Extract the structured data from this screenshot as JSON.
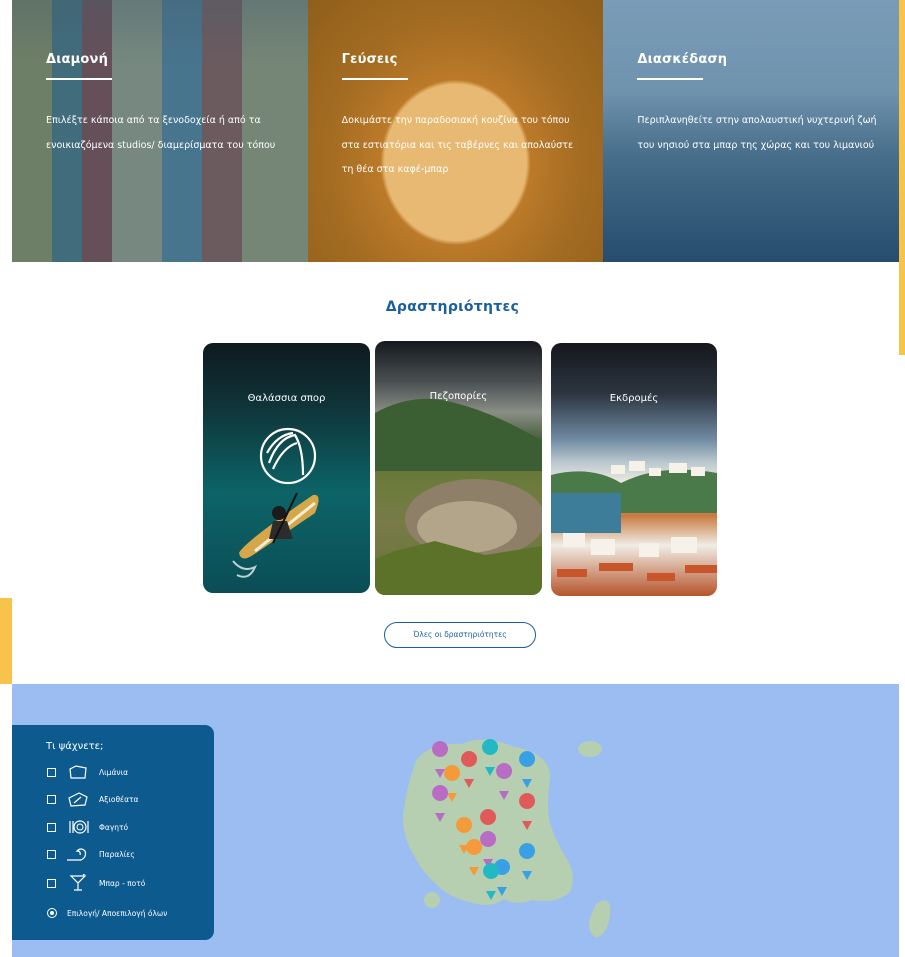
{
  "top_panels": [
    {
      "title": "Διαμονή",
      "text": "Επιλέξτε κάποια από τα ξενοδοχεία ή από τα ενοικιαζόμενα studios/ διαμερίσματα του τόπου"
    },
    {
      "title": "Γεύσεις",
      "text": "Δοκιμάστε την παραδοσιακή κουζίνα του τόπου στα εστιατόρια και τις ταβέρνες και απολαύστε τη θέα στα καφέ-μπαρ"
    },
    {
      "title": "Διασκέδαση",
      "text": "Περιπλανηθείτε στην απολαυστική νυχτερινή ζωή του νησιού στα μπαρ της χώρας και του λιμανιού"
    }
  ],
  "activities": {
    "title": "Δραστηριότητες",
    "cards": [
      {
        "label": "Θαλάσσια σπορ"
      },
      {
        "label": "Πεζοπορίες"
      },
      {
        "label": "Εκδρομές"
      }
    ],
    "all_button": "Όλες οι δραστηριότητες"
  },
  "map_filter": {
    "title": "Τι ψάχνετε;",
    "items": [
      {
        "label": "Λιμάνια",
        "icon": "harbor-icon"
      },
      {
        "label": "Αξιοθέατα",
        "icon": "sights-icon"
      },
      {
        "label": "Φαγητό",
        "icon": "food-icon"
      },
      {
        "label": "Παραλίες",
        "icon": "beach-icon"
      },
      {
        "label": "Μπαρ - ποτό",
        "icon": "cocktail-icon"
      }
    ],
    "toggle_all": "Επιλογή/ Αποεπιλογή όλων"
  },
  "colors": {
    "brand_blue": "#1a5f9e",
    "map_sea": "#9cbdf2",
    "map_land": "#b6cfb0",
    "filter_panel": "#0d5a8f",
    "pin_purple": "#b86cc4",
    "pin_orange": "#f59a3a",
    "pin_red": "#e05a5a",
    "pin_teal": "#22b8c4",
    "pin_blue": "#3aa0e6"
  }
}
